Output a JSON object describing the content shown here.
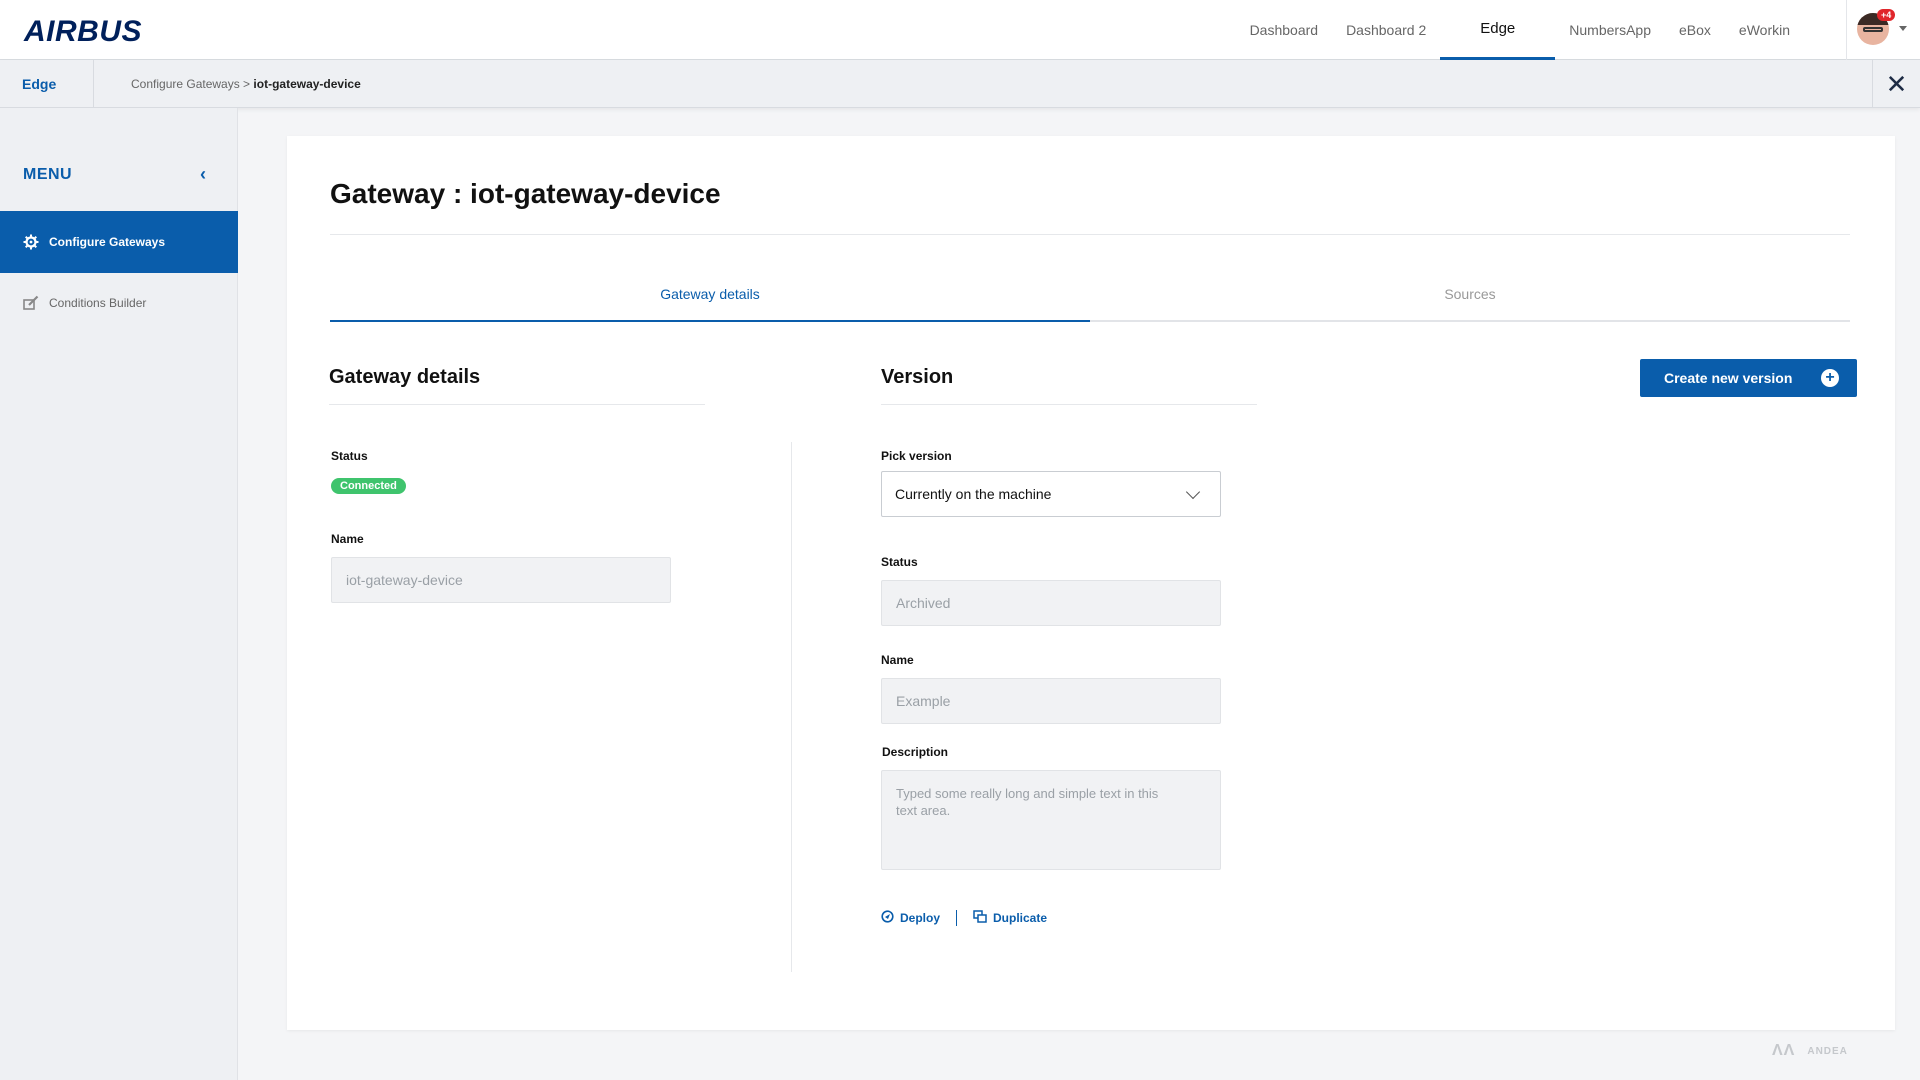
{
  "header": {
    "logo": "AIRBUS",
    "nav": [
      "Dashboard",
      "Dashboard 2",
      "Edge",
      "NumbersApp",
      "eBox",
      "eWorkin"
    ],
    "active_nav": "Edge",
    "notifications_badge": "+4"
  },
  "subbar": {
    "app_name": "Edge",
    "breadcrumb_parent": "Configure Gateways >",
    "breadcrumb_current": "iot-gateway-device",
    "close": "✕"
  },
  "sidebar": {
    "menu_title": "MENU",
    "collapse": "‹",
    "items": [
      {
        "label": "Configure Gateways",
        "icon": "gear-icon",
        "active": true
      },
      {
        "label": "Conditions Builder",
        "icon": "pencil-icon",
        "active": false
      }
    ]
  },
  "main": {
    "title": "Gateway : iot-gateway-device",
    "tabs": [
      {
        "label": "Gateway details",
        "active": true
      },
      {
        "label": "Sources",
        "active": false
      }
    ],
    "details": {
      "heading": "Gateway details",
      "status_label": "Status",
      "status_value": "Connected",
      "name_label": "Name",
      "name_value": "iot-gateway-device"
    },
    "version": {
      "heading": "Version",
      "create_button": "Create new version",
      "pick_label": "Pick version",
      "pick_value": "Currently on the machine",
      "status_label": "Status",
      "status_value": "Archived",
      "name_label": "Name",
      "name_value": "Example",
      "description_label": "Description",
      "description_value": "Typed some really long and simple text in this text area.",
      "deploy": "Deploy",
      "duplicate": "Duplicate"
    }
  },
  "footer": {
    "brand": "ANDEA"
  },
  "colors": {
    "primary": "#0a5dab",
    "success": "#3fc46d",
    "badge": "#e0262b",
    "brand": "#00205b"
  }
}
